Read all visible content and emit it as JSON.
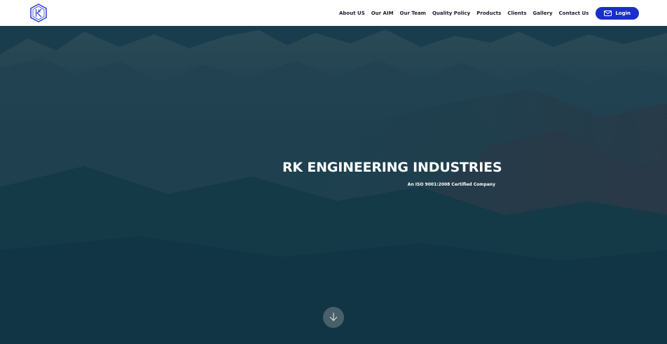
{
  "brand": {
    "logo_icon": "rk-logo-icon"
  },
  "nav": {
    "items": [
      {
        "label": "About US"
      },
      {
        "label": "Our AIM"
      },
      {
        "label": "Our Team"
      },
      {
        "label": "Quality Policy"
      },
      {
        "label": "Products"
      },
      {
        "label": "Clients"
      },
      {
        "label": "Gallery"
      },
      {
        "label": "Contact Us"
      }
    ],
    "login_label": "Login",
    "login_icon": "mail-icon"
  },
  "hero": {
    "title": "RK ENGINEERING INDUSTRIES",
    "subtitle": "An ISO 9001:2008 Certified Company",
    "scroll_icon": "arrow-down-icon"
  },
  "colors": {
    "accent": "#1a2fc9",
    "hero_tint": "#163c4b",
    "nav_bg": "#ffffff"
  }
}
